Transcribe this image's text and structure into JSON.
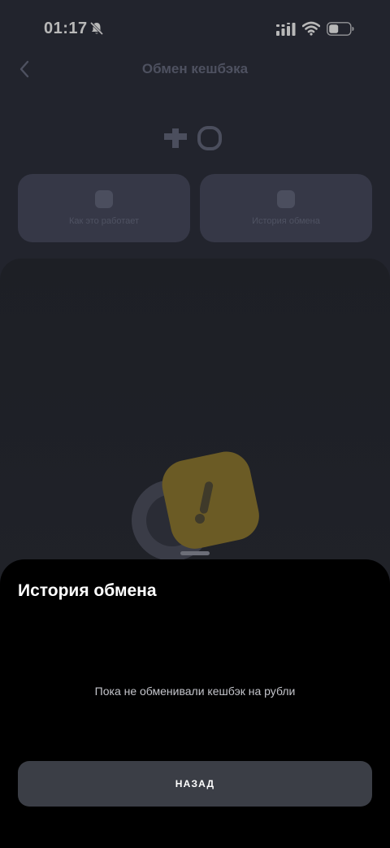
{
  "status_bar": {
    "time": "01:17"
  },
  "nav": {
    "title": "Обмен кешбэка"
  },
  "tiles": [
    {
      "label": "Как это работает"
    },
    {
      "label": "История обмена"
    }
  ],
  "sheet": {
    "title": "История обмена",
    "empty_text": "Пока не обменивали кешбэк на рубли",
    "back_label": "НАЗАД"
  },
  "colors": {
    "accent_yellow": "#c9a82c",
    "sheet_bg": "#000000",
    "button_bg": "#3b3e46"
  }
}
